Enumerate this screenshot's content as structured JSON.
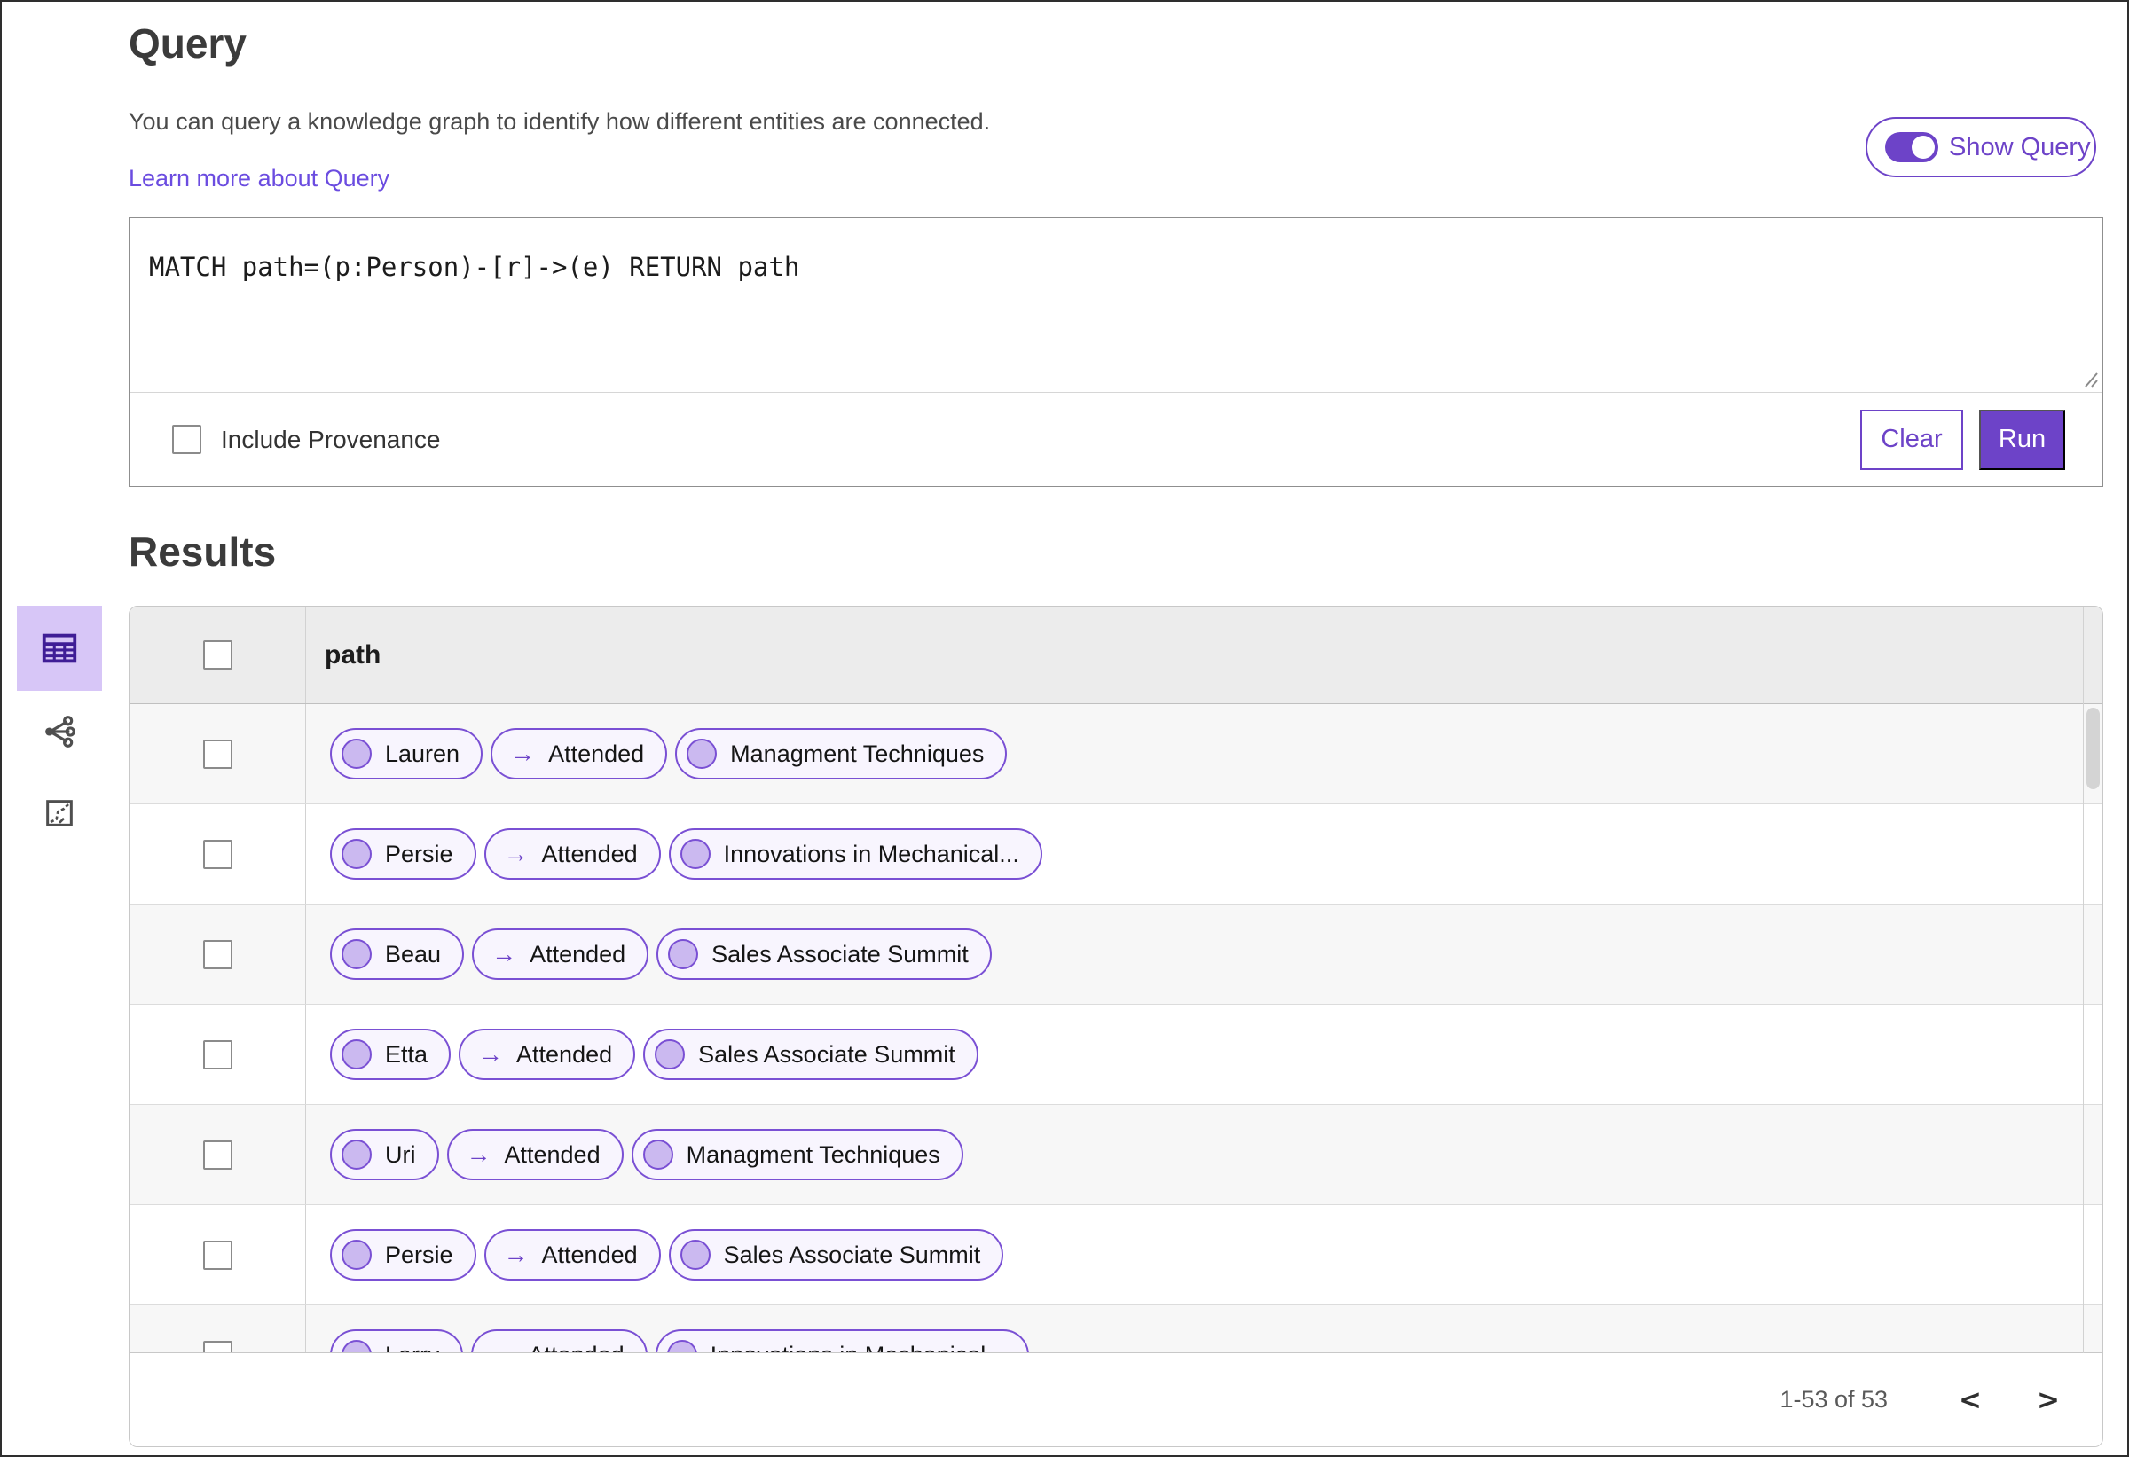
{
  "header": {
    "title": "Query",
    "description": "You can query a knowledge graph to identify how different entities are connected.",
    "learn_more_link": "Learn more about Query",
    "show_query_label": "Show Query",
    "show_query_toggle_state": "on"
  },
  "query_panel": {
    "query_text": "MATCH path=(p:Person)-[r]->(e) RETURN path",
    "include_provenance_label": "Include Provenance",
    "include_provenance_checked": false,
    "clear_label": "Clear",
    "run_label": "Run"
  },
  "results": {
    "title": "Results",
    "column_header": "path",
    "edge_arrow": "→",
    "view_icons": [
      {
        "name": "table-view-icon",
        "selected": true
      },
      {
        "name": "graph-view-icon",
        "selected": false
      },
      {
        "name": "chart-view-icon",
        "selected": false
      }
    ],
    "rows": [
      {
        "source": "Lauren",
        "edge": "Attended",
        "target": "Managment Techniques"
      },
      {
        "source": "Persie",
        "edge": "Attended",
        "target": "Innovations in Mechanical..."
      },
      {
        "source": "Beau",
        "edge": "Attended",
        "target": "Sales Associate Summit"
      },
      {
        "source": "Etta",
        "edge": "Attended",
        "target": "Sales Associate Summit"
      },
      {
        "source": "Uri",
        "edge": "Attended",
        "target": "Managment Techniques"
      },
      {
        "source": "Persie",
        "edge": "Attended",
        "target": "Sales Associate Summit"
      },
      {
        "source": "Larry",
        "edge": "Attended",
        "target": "Innovations in Mechanical..."
      }
    ],
    "pagination": {
      "range_text": "1-53 of 53",
      "prev_icon": "<",
      "next_icon": ">"
    }
  },
  "colors": {
    "accent_purple": "#6d43c8",
    "pill_border": "#7a50d4",
    "pill_background": "#f8f5fe",
    "node_dot_fill": "#cbb9f0",
    "selected_view_background": "#d7c6f7",
    "table_header_background": "#ececec",
    "striped_row_background": "#f7f7f7",
    "link_color": "#6b4ce0"
  }
}
